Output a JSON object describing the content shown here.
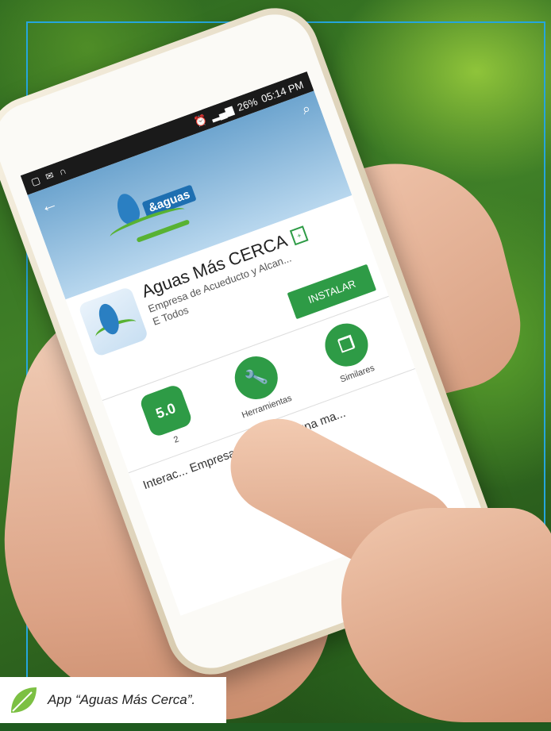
{
  "phone": {
    "status_time": "05:14 PM",
    "status_battery": "26%",
    "app_title": "Aguas Más CERCA",
    "app_developer": "Empresa de Acueducto y Alcan...",
    "content_rating": "Todos",
    "install_label": "INSTALAR",
    "logo_text": "&aguas",
    "badges": [
      {
        "value": "5.0",
        "label": "2"
      },
      {
        "value": "",
        "label": "Herramientas"
      },
      {
        "value": "",
        "label": "Similares"
      }
    ],
    "description": "Interac... Empresa de ... ágil, y una ma..."
  },
  "caption": {
    "text": "App “Aguas Más Cerca”."
  },
  "colors": {
    "frame": "#25a6dc",
    "install_green": "#2e9b46"
  }
}
